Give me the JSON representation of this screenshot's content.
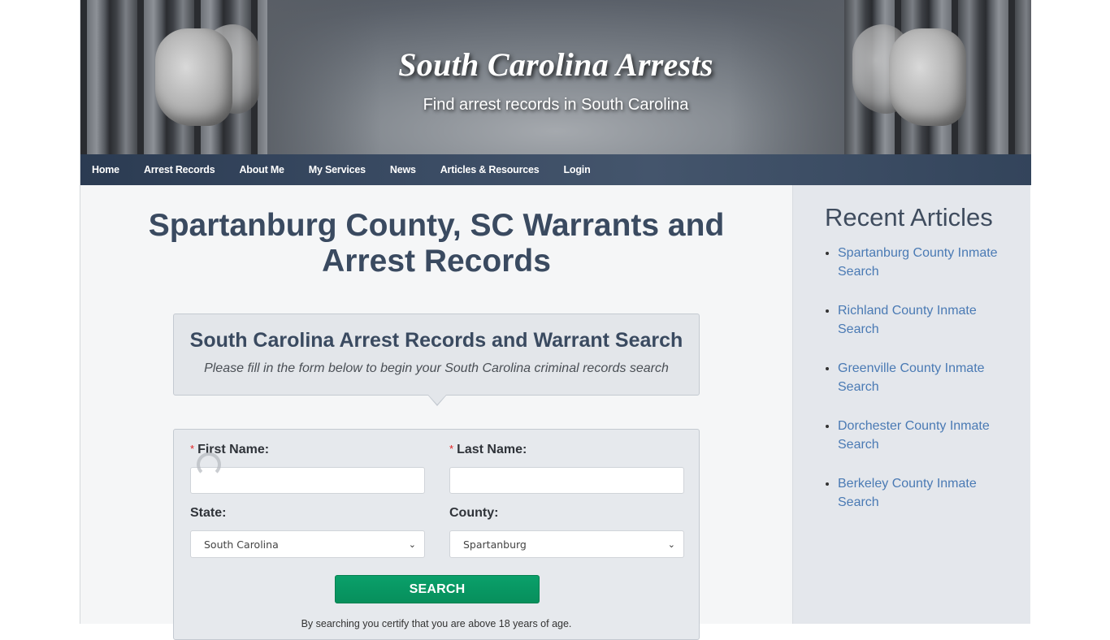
{
  "header": {
    "site_title": "South Carolina Arrests",
    "site_subtitle": "Find arrest records in South Carolina"
  },
  "nav": {
    "items": [
      {
        "label": "Home"
      },
      {
        "label": "Arrest Records"
      },
      {
        "label": "About Me"
      },
      {
        "label": "My Services"
      },
      {
        "label": "News"
      },
      {
        "label": "Articles & Resources"
      },
      {
        "label": "Login"
      }
    ]
  },
  "main": {
    "page_title": "Spartanburg County, SC Warrants and Arrest Records",
    "intro": {
      "title": "South Carolina Arrest Records and Warrant Search",
      "subtitle": "Please fill in the form below to begin your South Carolina criminal records search"
    },
    "form": {
      "required_marker": "*",
      "first_name_label": "First Name:",
      "first_name_value": "",
      "last_name_label": "Last Name:",
      "last_name_value": "",
      "state_label": "State:",
      "state_selected": "South Carolina",
      "county_label": "County:",
      "county_selected": "Spartanburg",
      "search_button": "SEARCH",
      "certify_text": "By searching you certify that you are above 18 years of age."
    }
  },
  "sidebar": {
    "title": "Recent Articles",
    "articles": [
      {
        "label": "Spartanburg County Inmate Search"
      },
      {
        "label": "Richland County Inmate Search"
      },
      {
        "label": "Greenville County Inmate Search"
      },
      {
        "label": "Dorchester County Inmate Search"
      },
      {
        "label": "Berkeley County Inmate Search"
      }
    ]
  },
  "colors": {
    "nav_bg": "#3a4b63",
    "heading": "#3a4a60",
    "link": "#4a7ab4",
    "search_button": "#0aa06a",
    "required": "#e02020"
  }
}
